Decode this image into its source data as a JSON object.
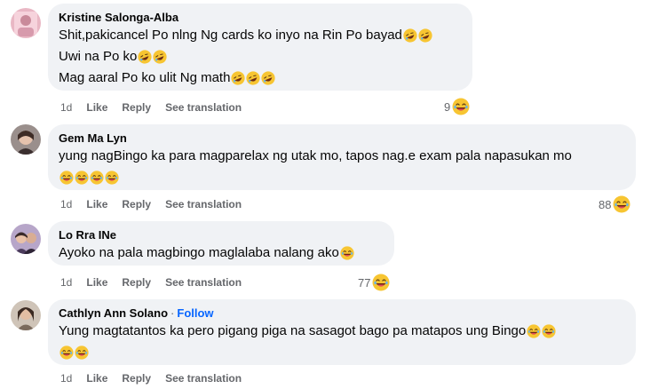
{
  "comments": [
    {
      "author": "Kristine Salonga-Alba",
      "follow": "",
      "lines": [
        "Shit,pakicancel Po nlng Ng cards ko inyo na Rin Po bayad",
        "Uwi na Po ko",
        "Mag aaral Po ko ulit Ng math"
      ],
      "line_emoji_counts": [
        2,
        2,
        3
      ],
      "emoji_line": 0,
      "time": "1d",
      "like_label": "Like",
      "reply_label": "Reply",
      "translate_label": "See translation",
      "reaction_count": "9",
      "reaction_icon": "laughing-emoji-icon"
    },
    {
      "author": "Gem Ma Lyn",
      "follow": "",
      "lines": [
        "yung nagBingo ka para magparelax ng utak mo, tapos nag.e exam pala napasukan mo"
      ],
      "line_emoji_counts": [
        0
      ],
      "emoji_line": 4,
      "time": "1d",
      "like_label": "Like",
      "reply_label": "Reply",
      "translate_label": "See translation",
      "reaction_count": "88",
      "reaction_icon": "laughing-emoji-icon"
    },
    {
      "author": "Lo Rra INe",
      "follow": "",
      "lines": [
        "Ayoko na pala magbingo maglalaba nalang ako"
      ],
      "line_emoji_counts": [
        1
      ],
      "emoji_line": 0,
      "time": "1d",
      "like_label": "Like",
      "reply_label": "Reply",
      "translate_label": "See translation",
      "reaction_count": "77",
      "reaction_icon": "laughing-emoji-icon"
    },
    {
      "author": "Cathlyn Ann Solano",
      "follow": "Follow",
      "lines": [
        "Yung magtatantos ka pero pigang piga na sasagot bago pa matapos ung Bingo"
      ],
      "line_emoji_counts": [
        2
      ],
      "emoji_line": 2,
      "time": "1d",
      "like_label": "Like",
      "reply_label": "Reply",
      "translate_label": "See translation",
      "reaction_count": "",
      "reaction_icon": ""
    }
  ],
  "separator": "·",
  "colors": {
    "bubble": "#f0f2f5",
    "meta_text": "#65676b",
    "follow": "#0866ff",
    "text": "#050505"
  }
}
